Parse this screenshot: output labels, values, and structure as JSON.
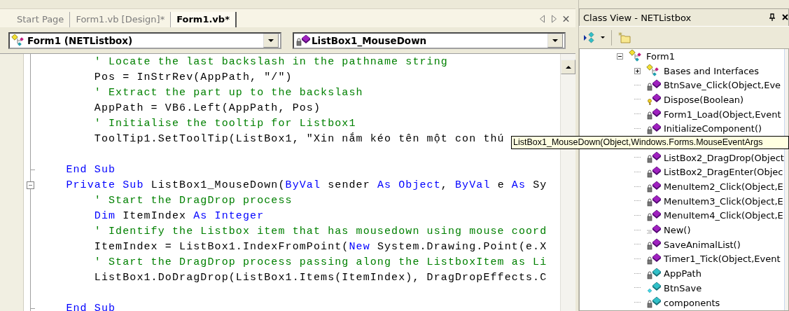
{
  "editor": {
    "tabs": [
      {
        "label": "Start Page",
        "selected": false
      },
      {
        "label": "Form1.vb [Design]*",
        "selected": false
      },
      {
        "label": "Form1.vb*",
        "selected": true
      }
    ],
    "class_dropdown": {
      "value": "Form1 (NETListbox)",
      "kind": "class"
    },
    "member_dropdown": {
      "value": "ListBox1_MouseDown",
      "kind": "private-method"
    },
    "code": [
      {
        "kind": "code",
        "tokens": [
          {
            "kind": "comment",
            "text": "        ' Locate the last backslash in the pathname string"
          }
        ]
      },
      {
        "kind": "code",
        "tokens": [
          {
            "kind": "plain",
            "text": "        Pos = InStrRev(AppPath, \"/\")"
          }
        ]
      },
      {
        "kind": "code",
        "tokens": [
          {
            "kind": "comment",
            "text": "        ' Extract the part up to the backslash"
          }
        ]
      },
      {
        "kind": "code",
        "tokens": [
          {
            "kind": "plain",
            "text": "        AppPath = VB6.Left(AppPath, Pos)"
          }
        ]
      },
      {
        "kind": "code",
        "tokens": [
          {
            "kind": "comment",
            "text": "        ' Initialise the tooltip for Listbox1"
          }
        ]
      },
      {
        "kind": "code",
        "tokens": [
          {
            "kind": "plain",
            "text": "        ToolTip1.SetToolTip(ListBox1, \"Xin nắm kéo tên một con thú"
          }
        ]
      },
      {
        "kind": "blank"
      },
      {
        "kind": "code",
        "block_end": true,
        "tokens": [
          {
            "kind": "keyword",
            "text": "    End Sub"
          }
        ]
      },
      {
        "kind": "code",
        "collapsible": true,
        "tokens": [
          {
            "kind": "keyword",
            "text": "    Private Sub"
          },
          {
            "kind": "plain",
            "text": " ListBox1_MouseDown("
          },
          {
            "kind": "keyword",
            "text": "ByVal"
          },
          {
            "kind": "plain",
            "text": " sender "
          },
          {
            "kind": "keyword",
            "text": "As Object"
          },
          {
            "kind": "plain",
            "text": ", "
          },
          {
            "kind": "keyword",
            "text": "ByVal"
          },
          {
            "kind": "plain",
            "text": " e "
          },
          {
            "kind": "keyword",
            "text": "As"
          },
          {
            "kind": "plain",
            "text": " Sy"
          }
        ]
      },
      {
        "kind": "code",
        "tokens": [
          {
            "kind": "comment",
            "text": "        ' Start the DragDrop process"
          }
        ]
      },
      {
        "kind": "code",
        "tokens": [
          {
            "kind": "keyword",
            "text": "        Dim"
          },
          {
            "kind": "plain",
            "text": " ItemIndex "
          },
          {
            "kind": "keyword",
            "text": "As Integer"
          }
        ]
      },
      {
        "kind": "code",
        "tokens": [
          {
            "kind": "comment",
            "text": "        ' Identify the Listbox item that has mousedown using mouse coord"
          }
        ]
      },
      {
        "kind": "code",
        "tokens": [
          {
            "kind": "plain",
            "text": "        ItemIndex = ListBox1.IndexFromPoint("
          },
          {
            "kind": "keyword",
            "text": "New"
          },
          {
            "kind": "plain",
            "text": " System.Drawing.Point(e.X"
          }
        ]
      },
      {
        "kind": "code",
        "tokens": [
          {
            "kind": "comment",
            "text": "        ' Start the DragDrop process passing along the ListboxItem as Li"
          }
        ]
      },
      {
        "kind": "code",
        "tokens": [
          {
            "kind": "plain",
            "text": "        ListBox1.DoDragDrop(ListBox1.Items(ItemIndex), DragDropEffects.C"
          }
        ]
      },
      {
        "kind": "blank"
      },
      {
        "kind": "code",
        "block_end": true,
        "tokens": [
          {
            "kind": "keyword",
            "text": "    End Sub"
          }
        ]
      }
    ]
  },
  "class_view": {
    "title": "Class View - NETListbox",
    "tree": [
      {
        "label": "Form1",
        "kind": "class",
        "expanded": true,
        "children": [
          {
            "label": "Bases and Interfaces",
            "kind": "class",
            "expanded": false
          },
          {
            "label": "BtnSave_Click(Object,Eve",
            "kind": "private-method"
          },
          {
            "label": "Dispose(Boolean)",
            "kind": "protected-method"
          },
          {
            "label": "Form1_Load(Object,Event",
            "kind": "private-method"
          },
          {
            "label": "InitializeComponent()",
            "kind": "private-method"
          },
          {
            "kind": "covered"
          },
          {
            "label": "ListBox2_DragDrop(Object",
            "kind": "private-method"
          },
          {
            "label": "ListBox2_DragEnter(Objec",
            "kind": "private-method"
          },
          {
            "label": "MenuItem2_Click(Object,E",
            "kind": "private-method"
          },
          {
            "label": "MenuItem3_Click(Object,E",
            "kind": "private-method"
          },
          {
            "label": "MenuItem4_Click(Object,E",
            "kind": "private-method"
          },
          {
            "label": "New()",
            "kind": "public-method"
          },
          {
            "label": "SaveAnimalList()",
            "kind": "private-method"
          },
          {
            "label": "Timer1_Tick(Object,Event",
            "kind": "private-method"
          },
          {
            "label": "AppPath",
            "kind": "private-field"
          },
          {
            "label": "BtnSave",
            "kind": "friend-field"
          },
          {
            "label": "components",
            "kind": "private-field"
          }
        ]
      }
    ]
  },
  "tooltip": {
    "text": "ListBox1_MouseDown(Object,Windows.Forms.MouseEventArgs"
  }
}
